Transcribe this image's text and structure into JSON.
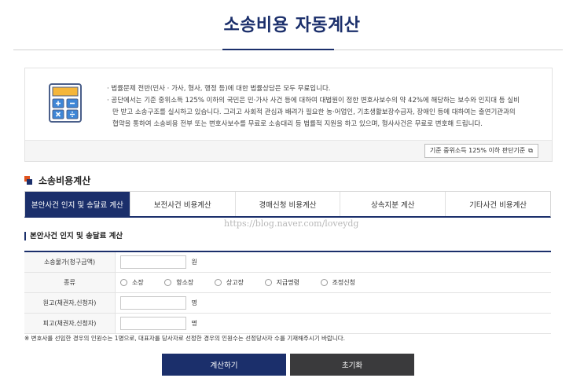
{
  "page": {
    "title": "소송비용 자동계산"
  },
  "info": {
    "lines": [
      "· 법률문제 전반(민사 · 가사, 형사, 행정 등)에 대한 법률상담은 모두 무료입니다.",
      "· 공단에서는 기준 중위소득 125% 이하의 국민은 민·가사 사건 등에 대하여 대법원이 정한 변호사보수의 약 42%에 해당하는 보수와 인지대 등 실비",
      "만 받고 소송구조를 실시하고 있습니다. 그리고 사회적 관심과 배려가 필요한 농·어업인, 기초생활보장수급자, 장애인 등에 대하여는 출연기관과의",
      "협약을 통하여 소송비용 전부 또는 변호사보수를 무료로 소송대리 등 법률적 지원을 하고 있으며, 형사사건은 무료로 변호해 드립니다."
    ],
    "criteria_button": "기준 중위소득 125% 이하 판단기준",
    "criteria_icon": "external-link-icon"
  },
  "section": {
    "title": "소송비용계산"
  },
  "tabs": [
    {
      "label": "본안사건 인지 및 송달료 계산",
      "active": true
    },
    {
      "label": "보전사건 비용계산",
      "active": false
    },
    {
      "label": "경매신청 비용계산",
      "active": false
    },
    {
      "label": "상속지분 계산",
      "active": false
    },
    {
      "label": "기타사건 비용계산",
      "active": false
    }
  ],
  "watermark": "https://blog.naver.com/loveydg",
  "form": {
    "title": "본안사건 인지 및 송달료 계산",
    "rows": {
      "amount": {
        "label": "소송물가(청구금액)",
        "value": "",
        "unit": "원"
      },
      "type": {
        "label": "종류",
        "options": [
          "소장",
          "항소장",
          "상고장",
          "지급명령",
          "조정신청"
        ]
      },
      "plaintiff": {
        "label": "원고(채권자,신청자)",
        "value": "",
        "unit": "명"
      },
      "defendant": {
        "label": "피고(채권자,신청자)",
        "value": "",
        "unit": "명"
      }
    },
    "note": "※ 변호사를 선임한 경우의 인원수는 1명으로, 대표자를 당사자로 선정한 경우의 인원수는 선정당사자 수를 기재해주시기 바랍니다."
  },
  "buttons": {
    "calculate": "계산하기",
    "reset": "초기화"
  },
  "colors": {
    "navy": "#1b2f6b",
    "orange": "#e0541f",
    "dark_button": "#3a3a3c"
  }
}
